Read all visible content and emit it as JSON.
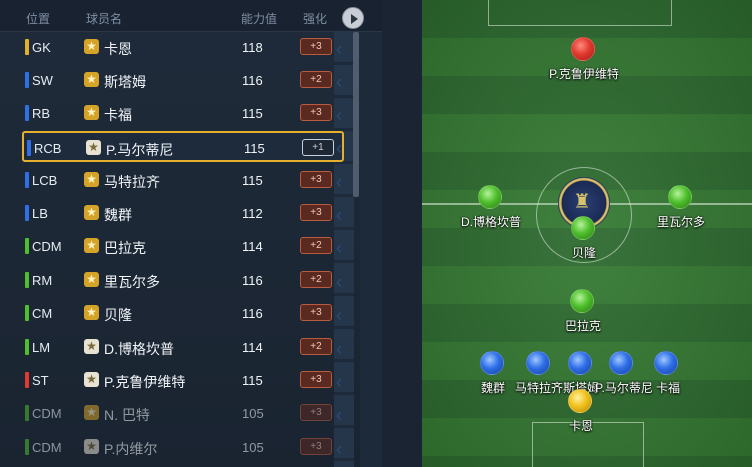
{
  "header": {
    "col_position": "位置",
    "col_name": "球员名",
    "col_rating": "能力值",
    "col_boost": "强化"
  },
  "players": [
    {
      "pos": "GK",
      "name": "卡恩",
      "rating": "118",
      "boost": "+3",
      "pos_color": "#e1b12c",
      "star": "gold"
    },
    {
      "pos": "SW",
      "name": "斯塔姆",
      "rating": "116",
      "boost": "+2",
      "pos_color": "#2f6fe8",
      "star": "gold"
    },
    {
      "pos": "RB",
      "name": "卡福",
      "rating": "115",
      "boost": "+3",
      "pos_color": "#2f6fe8",
      "star": "gold"
    },
    {
      "pos": "RCB",
      "name": "P.马尔蒂尼",
      "rating": "115",
      "boost": "+1",
      "pos_color": "#2f6fe8",
      "star": "white"
    },
    {
      "pos": "LCB",
      "name": "马特拉齐",
      "rating": "115",
      "boost": "+3",
      "pos_color": "#2f6fe8",
      "star": "gold"
    },
    {
      "pos": "LB",
      "name": "魏群",
      "rating": "112",
      "boost": "+3",
      "pos_color": "#2f6fe8",
      "star": "gold"
    },
    {
      "pos": "CDM",
      "name": "巴拉克",
      "rating": "114",
      "boost": "+2",
      "pos_color": "#4fc02d",
      "star": "gold"
    },
    {
      "pos": "RM",
      "name": "里瓦尔多",
      "rating": "116",
      "boost": "+2",
      "pos_color": "#4fc02d",
      "star": "gold"
    },
    {
      "pos": "CM",
      "name": "贝隆",
      "rating": "116",
      "boost": "+3",
      "pos_color": "#4fc02d",
      "star": "gold"
    },
    {
      "pos": "LM",
      "name": "D.博格坎普",
      "rating": "114",
      "boost": "+2",
      "pos_color": "#4fc02d",
      "star": "white"
    },
    {
      "pos": "ST",
      "name": "P.克鲁伊维特",
      "rating": "115",
      "boost": "+3",
      "pos_color": "#e23a2e",
      "star": "white"
    },
    {
      "pos": "CDM",
      "name": "N. 巴特",
      "rating": "105",
      "boost": "+3",
      "pos_color": "#4fc02d",
      "star": "gold"
    },
    {
      "pos": "CDM",
      "name": "P.内维尔",
      "rating": "105",
      "boost": "+3",
      "pos_color": "#4fc02d",
      "star": "white"
    }
  ],
  "pitch_players": [
    {
      "name": "P.克鲁伊维特",
      "color": "red"
    },
    {
      "name": "D.博格坎普",
      "color": "green"
    },
    {
      "name": "贝隆",
      "color": "green"
    },
    {
      "name": "里瓦尔多",
      "color": "green"
    },
    {
      "name": "巴拉克",
      "color": "green"
    },
    {
      "name": "魏群",
      "color": "blue"
    },
    {
      "name": "马特拉齐",
      "color": "blue"
    },
    {
      "name": "斯塔姆",
      "color": "blue"
    },
    {
      "name": "P.马尔蒂尼",
      "color": "blue"
    },
    {
      "name": "卡福",
      "color": "blue"
    },
    {
      "name": "卡恩",
      "color": "yellow"
    }
  ]
}
